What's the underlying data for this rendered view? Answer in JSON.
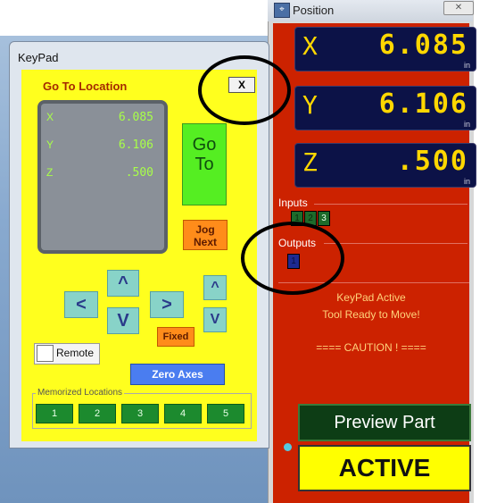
{
  "position_window": {
    "title": "Position",
    "close_label": "✕",
    "dro": [
      {
        "axis": "X",
        "value": "6.085",
        "unit": "in"
      },
      {
        "axis": "Y",
        "value": "6.106",
        "unit": "in"
      },
      {
        "axis": "Z",
        "value": ".500",
        "unit": "in"
      }
    ],
    "inputs_label": "Inputs",
    "inputs": [
      "1",
      "2",
      "3"
    ],
    "outputs_label": "Outputs",
    "outputs": [
      "1"
    ],
    "status_lines": [
      "KeyPad Active",
      "Tool Ready to Move!",
      "==== CAUTION ! ===="
    ],
    "preview_button": "Preview Part",
    "active_label": "ACTIVE"
  },
  "keypad_window": {
    "title": "KeyPad",
    "heading": "Go To Location",
    "close_label": "X",
    "display": [
      {
        "axis": "X",
        "value": "6.085"
      },
      {
        "axis": "Y",
        "value": "6.106"
      },
      {
        "axis": "Z",
        "value": ".500"
      }
    ],
    "go_label_1": "Go",
    "go_label_2": "To",
    "jog_label_1": "Jog",
    "jog_label_2": "Next",
    "arrow_left": "<",
    "arrow_right": ">",
    "arrow_up": "^",
    "arrow_down": "V",
    "z_up": "^",
    "z_down": "V",
    "fixed_label": "Fixed",
    "remote_label": "Remote",
    "zero_axes_label": "Zero Axes",
    "memorized_label": "Memorized Locations",
    "memorized": [
      "1",
      "2",
      "3",
      "4",
      "5"
    ]
  },
  "colors": {
    "keypad_bg": "#ffff1e",
    "position_bg": "#cc2200",
    "dro_bg": "#0c1247",
    "dro_text": "#ffd700"
  }
}
